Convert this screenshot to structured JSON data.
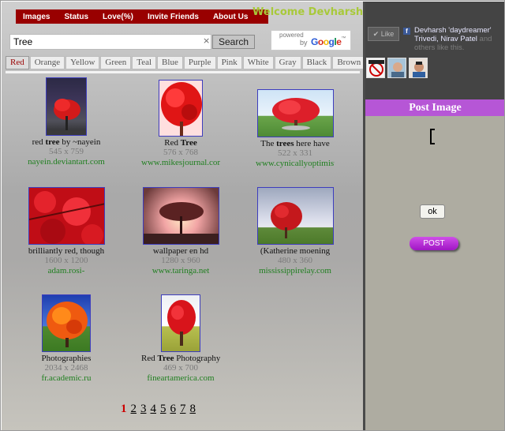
{
  "nav": {
    "items": [
      "Images",
      "Status",
      "Love(%)",
      "Invite Friends",
      "About Us"
    ]
  },
  "welcome": "Welcome Devharsh 'daydreamer' Trivedi",
  "search": {
    "value": "Tree",
    "clear": "×",
    "button": "Search"
  },
  "google": {
    "powered": "powered",
    "by": "by",
    "brand": "Google",
    "tm": "™"
  },
  "color_tabs": [
    "Red",
    "Orange",
    "Yellow",
    "Green",
    "Teal",
    "Blue",
    "Purple",
    "Pink",
    "White",
    "Gray",
    "Black",
    "Brown"
  ],
  "active_tab": "Red",
  "results": [
    {
      "cap_pre": "red ",
      "cap_bold": "tree",
      "cap_post": " by ~nayein",
      "dim": "545 x 759",
      "src": "nayein.deviantart.com"
    },
    {
      "cap_pre": "Red ",
      "cap_bold": "Tree",
      "cap_post": "",
      "dim": "576 x 768",
      "src": "www.mikesjournal.com"
    },
    {
      "cap_pre": "The ",
      "cap_bold": "trees",
      "cap_post": " here have",
      "dim": "522 x 331",
      "src": "www.cynicallyoptimistic.com"
    },
    {
      "cap_pre": "brilliantly red, though",
      "cap_bold": "",
      "cap_post": "",
      "dim": "1600 x 1200",
      "src": "adam.rosi-"
    },
    {
      "cap_pre": "wallpaper en hd",
      "cap_bold": "",
      "cap_post": "",
      "dim": "1280 x 960",
      "src": "www.taringa.net"
    },
    {
      "cap_pre": "(Katherine moening",
      "cap_bold": "",
      "cap_post": "",
      "dim": "480 x 360",
      "src": "mississippirelay.com"
    },
    {
      "cap_pre": "Photographies",
      "cap_bold": "",
      "cap_post": "",
      "dim": "2034 x 2468",
      "src": "fr.academic.ru"
    },
    {
      "cap_pre": "Red ",
      "cap_bold": "Tree",
      "cap_post": " Photography",
      "dim": "469 x 700",
      "src": "fineartamerica.com"
    }
  ],
  "pager": {
    "current": "1",
    "pages": [
      "2",
      "3",
      "4",
      "5",
      "6",
      "7",
      "8"
    ]
  },
  "facebook": {
    "like_label": "Like",
    "like_names": "Devharsh 'daydreamer' Trivedi, Nirav Patel",
    "like_suffix": " and others like this."
  },
  "post": {
    "heading": "Post Image",
    "ok": "ok",
    "post_button": "POST"
  },
  "colors": {
    "nav_bg": "#990000",
    "welcome": "#a8c93a",
    "post_head": "#b656d6",
    "source_link": "#1f7f1f"
  }
}
